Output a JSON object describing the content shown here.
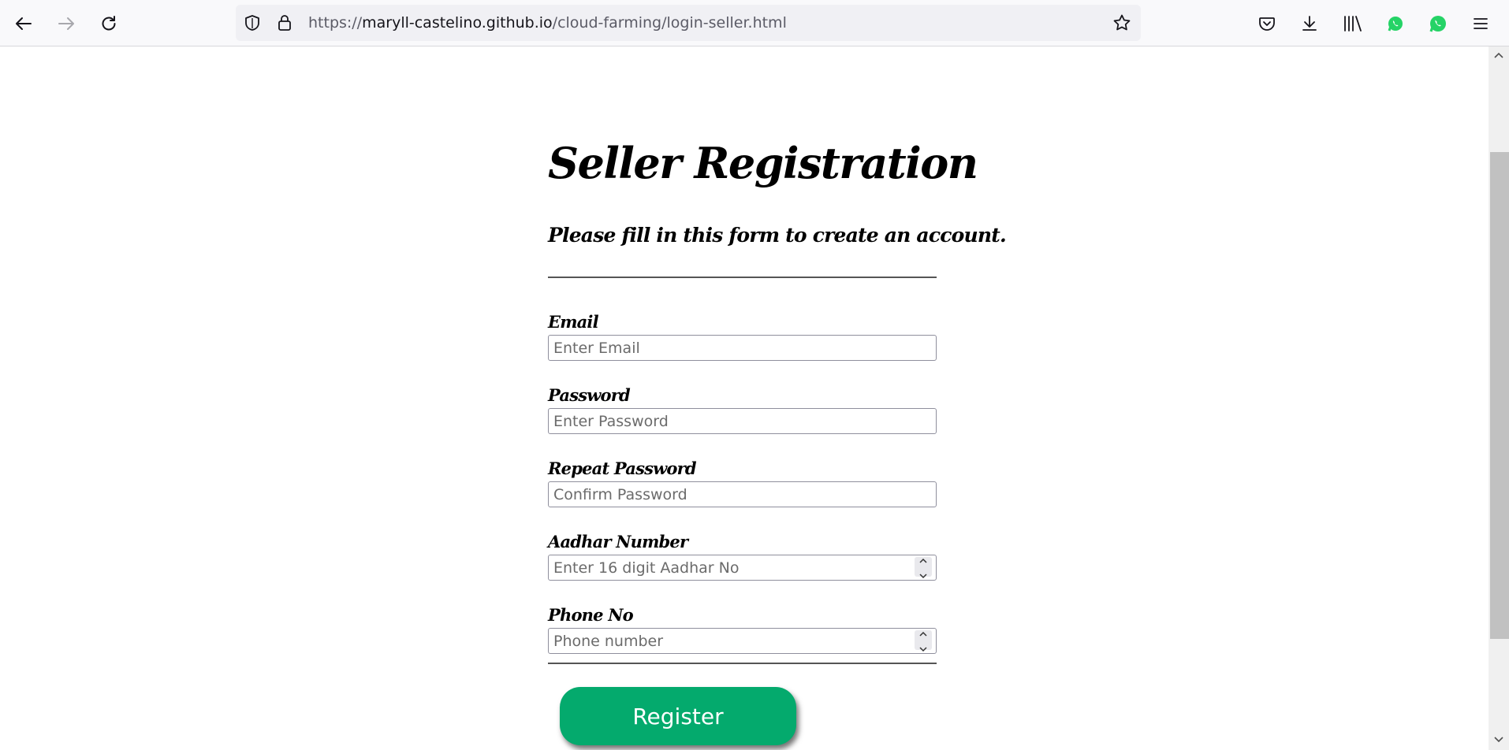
{
  "browser": {
    "url_prefix": "https://",
    "url_host": "maryll-castelino.github.io",
    "url_path": "/cloud-farming/login-seller.html",
    "icons": {
      "back": "back-arrow-icon",
      "forward": "forward-arrow-icon",
      "reload": "reload-icon",
      "shield": "tracking-shield-icon",
      "lock": "lock-icon",
      "star": "bookmark-star-icon",
      "pocket": "pocket-icon",
      "downloads": "downloads-icon",
      "library": "library-icon",
      "whatsapp": "whatsapp-icon",
      "menu": "hamburger-menu-icon"
    }
  },
  "form": {
    "title": "Seller Registration",
    "subtitle": "Please fill in this form to create an account.",
    "fields": [
      {
        "label": "Email",
        "placeholder": "Enter Email",
        "type": "text"
      },
      {
        "label": "Password",
        "placeholder": "Enter Password",
        "type": "password"
      },
      {
        "label": "Repeat Password",
        "placeholder": "Confirm Password",
        "type": "password"
      },
      {
        "label": "Aadhar Number",
        "placeholder": "Enter 16 digit Aadhar No",
        "type": "number"
      },
      {
        "label": "Phone No",
        "placeholder": "Phone number",
        "type": "number"
      }
    ],
    "submit_label": "Register"
  },
  "colors": {
    "register_button": "#04aa6d",
    "whatsapp": "#25d366",
    "toolbar_bg": "#f9f9fb",
    "urlbar_bg": "#f0f0f4"
  }
}
